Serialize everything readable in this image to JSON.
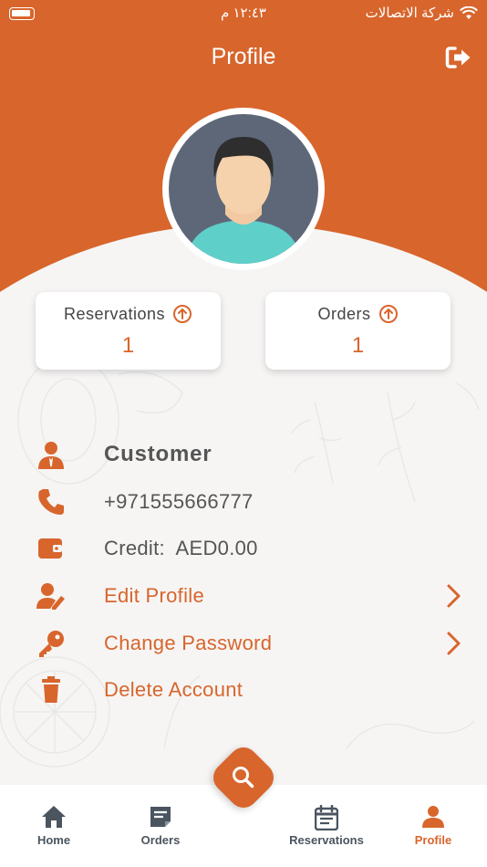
{
  "status_bar": {
    "time": "١٢:٤٣ م",
    "carrier": "شركة الاتصالات"
  },
  "header": {
    "title": "Profile"
  },
  "stats": [
    {
      "label": "Reservations",
      "value": "1"
    },
    {
      "label": "Orders",
      "value": "1"
    }
  ],
  "profile": {
    "name": "Customer",
    "phone": "+971555666777",
    "credit_label": "Credit:",
    "credit_value": "AED0.00"
  },
  "actions": {
    "edit_profile": "Edit Profile",
    "change_password": "Change Password",
    "delete_account": "Delete Account"
  },
  "tabs": [
    {
      "label": "Home",
      "icon": "home-icon"
    },
    {
      "label": "Orders",
      "icon": "orders-icon"
    },
    {
      "label": "Reservations",
      "icon": "calendar-icon"
    },
    {
      "label": "Profile",
      "icon": "person-icon",
      "active": true
    }
  ],
  "colors": {
    "accent": "#d8652c",
    "text": "#555555",
    "tab_inactive": "#4a5560"
  }
}
